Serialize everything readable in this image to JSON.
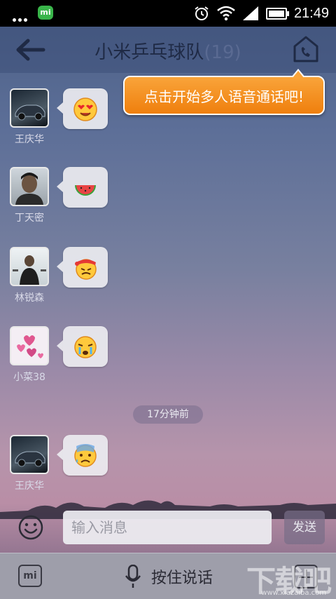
{
  "status_bar": {
    "time": "21:49",
    "notification_app": "mi"
  },
  "header": {
    "title": "小米乒乓球队",
    "member_count": "(19)"
  },
  "tooltip": {
    "text": "点击开始多人语音通话吧!"
  },
  "messages": [
    {
      "sender": "王庆华",
      "emoji": "heart-eyes-emoji"
    },
    {
      "sender": "丁天密",
      "emoji": "watermelon-emoji"
    },
    {
      "sender": "林锐森",
      "emoji": "angry-bandana-emoji"
    },
    {
      "sender": "小菜38",
      "emoji": "crying-emoji"
    },
    {
      "sender": "王庆华",
      "emoji": "anxious-sweat-emoji"
    }
  ],
  "time_separator": "17分钟前",
  "input": {
    "placeholder": "输入消息",
    "send_label": "发送"
  },
  "bottom": {
    "mi_label": "mi",
    "push_to_talk_label": "按住说话"
  },
  "watermark": {
    "text": "下载吧",
    "url": "www.xiazaiba.com"
  },
  "colors": {
    "tooltip_orange": "#f39220",
    "header_bg": "#3c4e78",
    "bottom_bar": "#9e9eaa"
  }
}
